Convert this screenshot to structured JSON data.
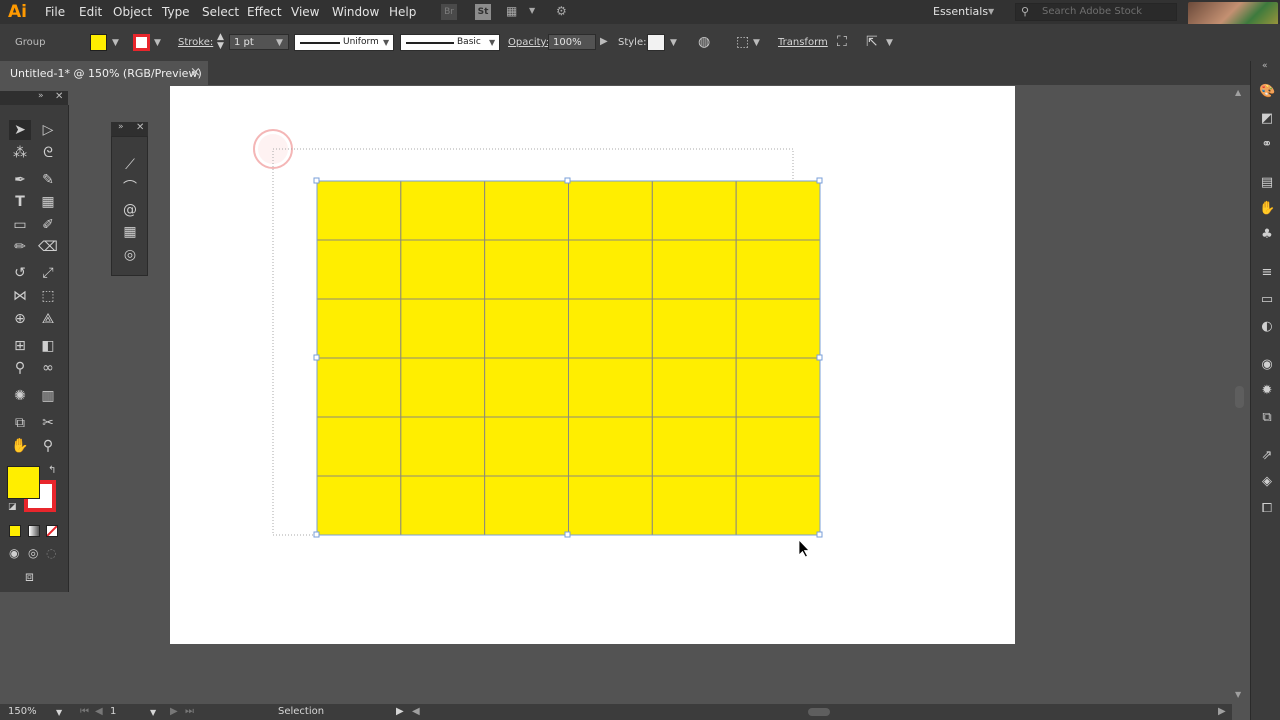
{
  "app": {
    "logo": "Ai"
  },
  "menu": [
    "File",
    "Edit",
    "Object",
    "Type",
    "Select",
    "Effect",
    "View",
    "Window",
    "Help"
  ],
  "header": {
    "bridge_label": "Br",
    "stock_label": "St",
    "workspace": "Essentials",
    "search_placeholder": "Search Adobe Stock"
  },
  "control_bar": {
    "selection_type": "Group",
    "fill_color": "#ffee00",
    "stroke_color": "#ff2a2a",
    "stroke_label": "Stroke:",
    "stroke_weight": "1 pt",
    "stroke_profile": "Uniform",
    "brush": "Basic",
    "opacity_label": "Opacity:",
    "opacity_value": "100%",
    "style_label": "Style:",
    "transform_label": "Transform"
  },
  "document": {
    "tab_title": "Untitled-1* @ 150% (RGB/Preview)",
    "close": "×",
    "grid_fill": "#ffee00",
    "grid_rows": 6,
    "grid_cols": 6
  },
  "tools_panel": {
    "fill_swatch": "#ffee00",
    "stroke_swatch": "#e8262c"
  },
  "status_bar": {
    "zoom": "150%",
    "artboard_number": "1",
    "current_tool": "Selection"
  }
}
